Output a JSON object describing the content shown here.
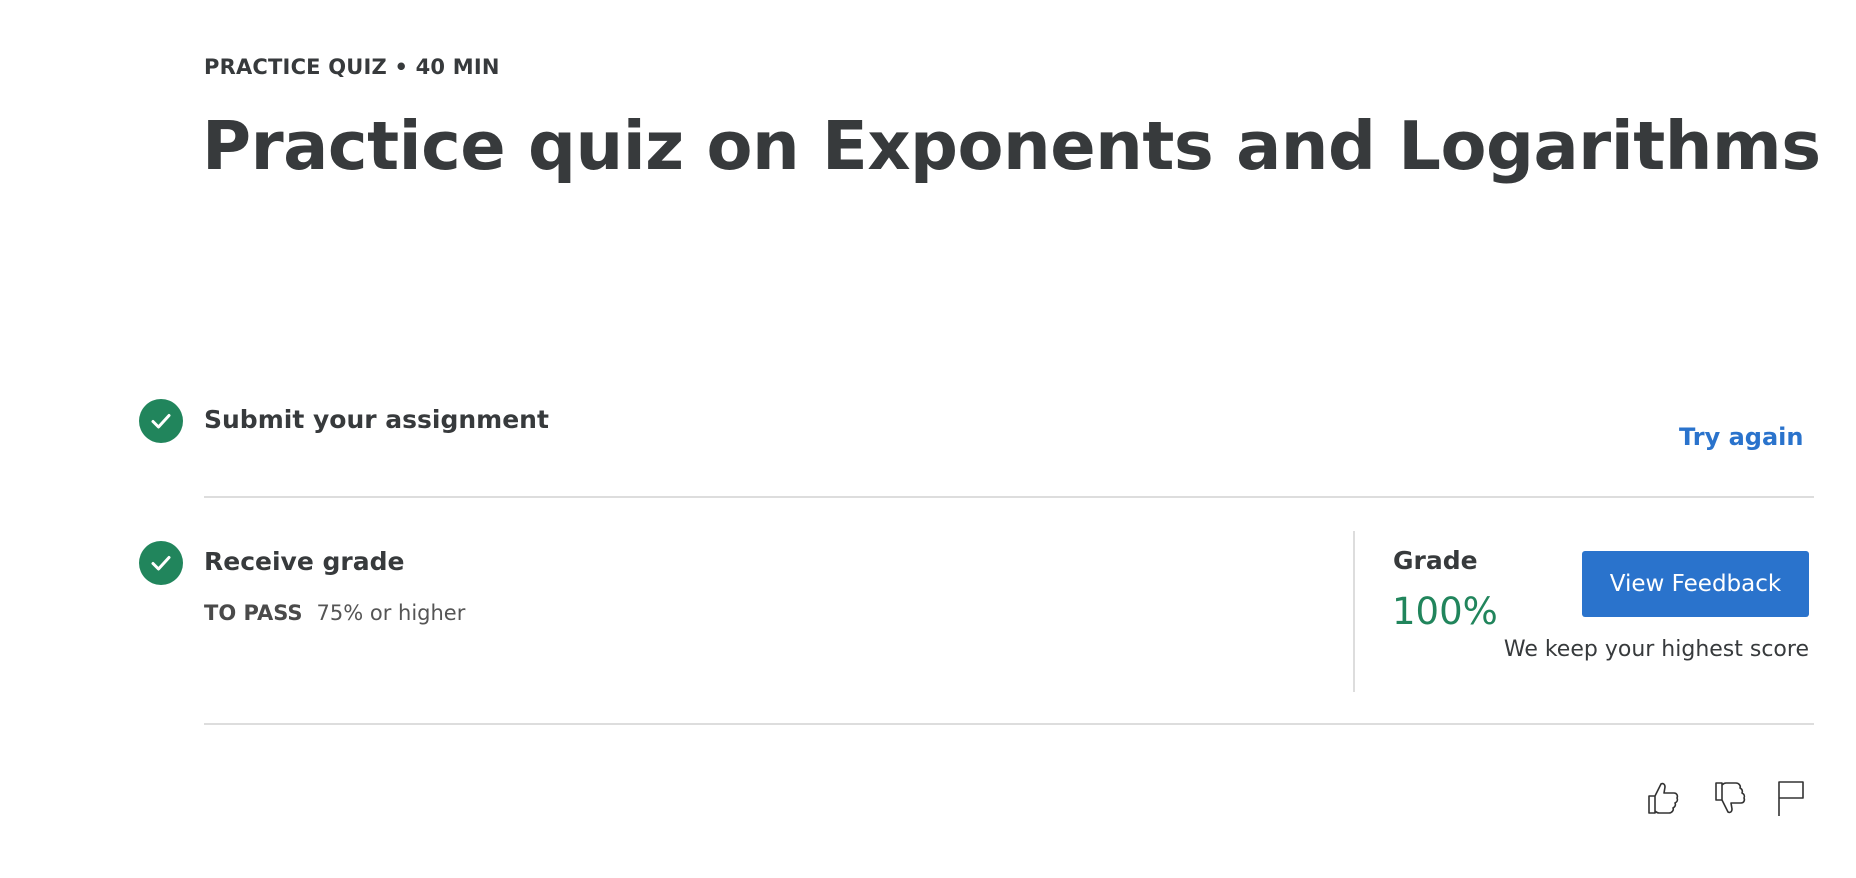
{
  "header": {
    "eyebrow": "PRACTICE QUIZ • 40 MIN",
    "title": "Practice quiz on Exponents and Logarithms"
  },
  "steps": {
    "submit": {
      "title": "Submit your assignment",
      "action_label": "Try again",
      "status_icon": "check-circle-icon"
    },
    "grade": {
      "title": "Receive grade",
      "to_pass_label": "TO PASS",
      "to_pass_value": "75% or higher",
      "status_icon": "check-circle-icon"
    }
  },
  "grade_panel": {
    "label": "Grade",
    "value": "100%",
    "button_label": "View Feedback",
    "note": "We keep your highest score"
  },
  "feedback_icons": [
    "thumbs-up-icon",
    "thumbs-down-icon",
    "flag-icon"
  ],
  "colors": {
    "text": "#373a3c",
    "success": "#21855c",
    "accent": "#2a73cc",
    "divider": "#dddddd"
  }
}
